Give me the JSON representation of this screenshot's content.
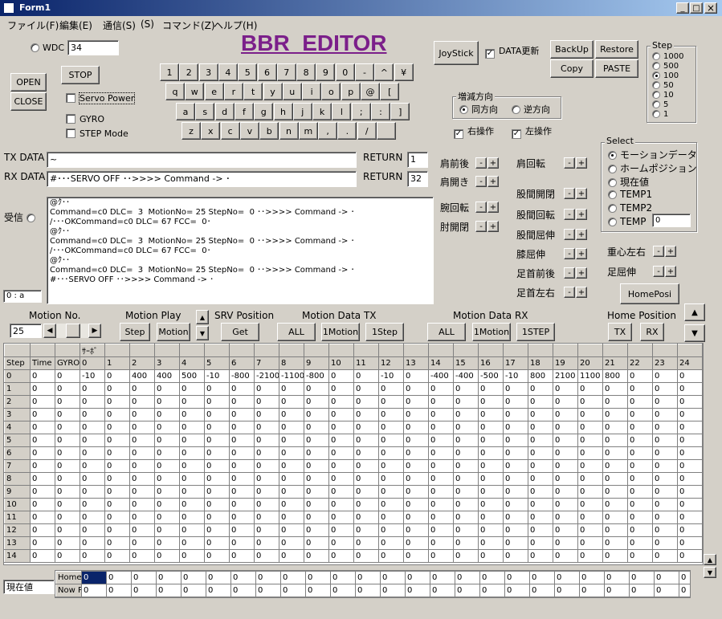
{
  "window": {
    "title": "Form1",
    "minimize": "_",
    "maximize": "□",
    "close": "×"
  },
  "menu": [
    "ファイル(F)",
    "編集(E)",
    "通信(S)",
    "(S)",
    "コマンド(Z)",
    "ヘルプ(H)"
  ],
  "app_title": "BBR  EDITOR",
  "wdc": {
    "label": "WDC",
    "value": "34"
  },
  "open_label": "OPEN",
  "close_label": "CLOSE",
  "stop_label": "STOP",
  "servo_power": "Servo Power",
  "gyro": "GYRO",
  "step_mode": "STEP Mode",
  "keyboard": [
    [
      "1",
      "2",
      "3",
      "4",
      "5",
      "6",
      "7",
      "8",
      "9",
      "0",
      "-",
      "^",
      "¥"
    ],
    [
      "q",
      "w",
      "e",
      "r",
      "t",
      "y",
      "u",
      "i",
      "o",
      "p",
      "@",
      "["
    ],
    [
      "a",
      "s",
      "d",
      "f",
      "g",
      "h",
      "j",
      "k",
      "l",
      ";",
      ":",
      "]"
    ],
    [
      "z",
      "x",
      "c",
      "v",
      "b",
      "n",
      "m",
      ",",
      ".",
      "/",
      ""
    ]
  ],
  "joystick": "JoyStick",
  "data_update": "DATA更新",
  "backup": "BackUp",
  "restore": "Restore",
  "copy": "Copy",
  "paste": "PASTE",
  "step_group": {
    "title": "Step",
    "options": [
      "1000",
      "500",
      "100",
      "50",
      "10",
      "5",
      "1"
    ],
    "selected": "100"
  },
  "direction": {
    "title": "増減方向",
    "same": "同方向",
    "reverse": "逆方向"
  },
  "right_op": "右操作",
  "left_op": "左操作",
  "tx": {
    "label": "TX DATA",
    "value": "~",
    "return_label": "RETURN",
    "return_value": "1"
  },
  "rx": {
    "label": "RX DATA",
    "value": "#･･･SERVO OFF ･･>>>> Command -> ･",
    "return_label": "RETURN",
    "return_value": "32"
  },
  "receive": {
    "label": "受信",
    "lines": [
      "@ｸ･･",
      "Command=c0 DLC=  3  MotionNo= 25 StepNo=  0 ･･>>>> Command -> ･",
      "/･･･OKCommand=c0 DLC= 67 FCC=  0･",
      "@ｸ･･",
      "Command=c0 DLC=  3  MotionNo= 25 StepNo=  0 ･･>>>> Command -> ･",
      "/･･･OKCommand=c0 DLC= 67 FCC=  0･",
      "@ｸ･･",
      "Command=c0 DLC=  3  MotionNo= 25 StepNo=  0 ･･>>>> Command -> ･",
      "#･･･SERVO OFF ･･>>>> Command -> ･"
    ]
  },
  "spin_value": "0 : a",
  "joints_left": [
    "肩前後",
    "肩開き",
    "腕回転",
    "肘開閉"
  ],
  "joints_right": [
    "肩回転",
    "股間開閉",
    "股間回転",
    "股間屈伸",
    "膝屈伸",
    "足首前後",
    "足首左右"
  ],
  "minus": "-",
  "plus": "+",
  "select_group": {
    "title": "Select",
    "options": [
      "モーションデータ",
      "ホームポジション",
      "現在値",
      "TEMP1",
      "TEMP2",
      "TEMP"
    ],
    "selected": "モーションデータ",
    "temp_value": "0"
  },
  "center_lr": "重心左右",
  "foot_flex": "足屈伸",
  "homeposi": "HomePosi",
  "motion_no": {
    "label": "Motion No.",
    "value": "25"
  },
  "motion_play": {
    "label": "Motion Play",
    "step": "Step",
    "motion": "Motion"
  },
  "srv_position": {
    "label": "SRV Position",
    "get": "Get"
  },
  "motion_tx": {
    "label": "Motion Data TX",
    "all": "ALL",
    "one_motion": "1Motion",
    "one_step": "1Step"
  },
  "motion_rx": {
    "label": "Motion Data RX",
    "all": "ALL",
    "one_motion": "1Motion",
    "one_step": "1STEP"
  },
  "home_position": {
    "label": "Home Position",
    "tx": "TX",
    "rx": "RX"
  },
  "grid": {
    "super": [
      "",
      "",
      "",
      "ｻｰﾎﾞ"
    ],
    "headers": [
      "Step",
      "Time",
      "GYRO",
      "0",
      "1",
      "2",
      "3",
      "4",
      "5",
      "6",
      "7",
      "8",
      "9",
      "10",
      "11",
      "12",
      "13",
      "14",
      "15",
      "16",
      "17",
      "18",
      "19",
      "20",
      "21",
      "22",
      "23",
      "24"
    ],
    "rows": [
      [
        "0",
        "0",
        "0",
        "-10",
        "0",
        "400",
        "400",
        "500",
        "-10",
        "-800",
        "-2100",
        "-1100",
        "-800",
        "0",
        "0",
        "-10",
        "0",
        "-400",
        "-400",
        "-500",
        "-10",
        "800",
        "2100",
        "1100",
        "800",
        "0",
        "0",
        "0"
      ],
      [
        "1",
        "0",
        "0",
        "0",
        "0",
        "0",
        "0",
        "0",
        "0",
        "0",
        "0",
        "0",
        "0",
        "0",
        "0",
        "0",
        "0",
        "0",
        "0",
        "0",
        "0",
        "0",
        "0",
        "0",
        "0",
        "0",
        "0",
        "0"
      ],
      [
        "2",
        "0",
        "0",
        "0",
        "0",
        "0",
        "0",
        "0",
        "0",
        "0",
        "0",
        "0",
        "0",
        "0",
        "0",
        "0",
        "0",
        "0",
        "0",
        "0",
        "0",
        "0",
        "0",
        "0",
        "0",
        "0",
        "0",
        "0"
      ],
      [
        "3",
        "0",
        "0",
        "0",
        "0",
        "0",
        "0",
        "0",
        "0",
        "0",
        "0",
        "0",
        "0",
        "0",
        "0",
        "0",
        "0",
        "0",
        "0",
        "0",
        "0",
        "0",
        "0",
        "0",
        "0",
        "0",
        "0",
        "0"
      ],
      [
        "4",
        "0",
        "0",
        "0",
        "0",
        "0",
        "0",
        "0",
        "0",
        "0",
        "0",
        "0",
        "0",
        "0",
        "0",
        "0",
        "0",
        "0",
        "0",
        "0",
        "0",
        "0",
        "0",
        "0",
        "0",
        "0",
        "0",
        "0"
      ],
      [
        "5",
        "0",
        "0",
        "0",
        "0",
        "0",
        "0",
        "0",
        "0",
        "0",
        "0",
        "0",
        "0",
        "0",
        "0",
        "0",
        "0",
        "0",
        "0",
        "0",
        "0",
        "0",
        "0",
        "0",
        "0",
        "0",
        "0",
        "0"
      ],
      [
        "6",
        "0",
        "0",
        "0",
        "0",
        "0",
        "0",
        "0",
        "0",
        "0",
        "0",
        "0",
        "0",
        "0",
        "0",
        "0",
        "0",
        "0",
        "0",
        "0",
        "0",
        "0",
        "0",
        "0",
        "0",
        "0",
        "0",
        "0"
      ],
      [
        "7",
        "0",
        "0",
        "0",
        "0",
        "0",
        "0",
        "0",
        "0",
        "0",
        "0",
        "0",
        "0",
        "0",
        "0",
        "0",
        "0",
        "0",
        "0",
        "0",
        "0",
        "0",
        "0",
        "0",
        "0",
        "0",
        "0",
        "0"
      ],
      [
        "8",
        "0",
        "0",
        "0",
        "0",
        "0",
        "0",
        "0",
        "0",
        "0",
        "0",
        "0",
        "0",
        "0",
        "0",
        "0",
        "0",
        "0",
        "0",
        "0",
        "0",
        "0",
        "0",
        "0",
        "0",
        "0",
        "0",
        "0"
      ],
      [
        "9",
        "0",
        "0",
        "0",
        "0",
        "0",
        "0",
        "0",
        "0",
        "0",
        "0",
        "0",
        "0",
        "0",
        "0",
        "0",
        "0",
        "0",
        "0",
        "0",
        "0",
        "0",
        "0",
        "0",
        "0",
        "0",
        "0",
        "0"
      ],
      [
        "10",
        "0",
        "0",
        "0",
        "0",
        "0",
        "0",
        "0",
        "0",
        "0",
        "0",
        "0",
        "0",
        "0",
        "0",
        "0",
        "0",
        "0",
        "0",
        "0",
        "0",
        "0",
        "0",
        "0",
        "0",
        "0",
        "0",
        "0"
      ],
      [
        "11",
        "0",
        "0",
        "0",
        "0",
        "0",
        "0",
        "0",
        "0",
        "0",
        "0",
        "0",
        "0",
        "0",
        "0",
        "0",
        "0",
        "0",
        "0",
        "0",
        "0",
        "0",
        "0",
        "0",
        "0",
        "0",
        "0",
        "0"
      ],
      [
        "12",
        "0",
        "0",
        "0",
        "0",
        "0",
        "0",
        "0",
        "0",
        "0",
        "0",
        "0",
        "0",
        "0",
        "0",
        "0",
        "0",
        "0",
        "0",
        "0",
        "0",
        "0",
        "0",
        "0",
        "0",
        "0",
        "0",
        "0"
      ],
      [
        "13",
        "0",
        "0",
        "0",
        "0",
        "0",
        "0",
        "0",
        "0",
        "0",
        "0",
        "0",
        "0",
        "0",
        "0",
        "0",
        "0",
        "0",
        "0",
        "0",
        "0",
        "0",
        "0",
        "0",
        "0",
        "0",
        "0",
        "0"
      ],
      [
        "14",
        "0",
        "0",
        "0",
        "0",
        "0",
        "0",
        "0",
        "0",
        "0",
        "0",
        "0",
        "0",
        "0",
        "0",
        "0",
        "0",
        "0",
        "0",
        "0",
        "0",
        "0",
        "0",
        "0",
        "0",
        "0",
        "0",
        "0"
      ]
    ]
  },
  "bottom": {
    "selector": "現在値",
    "rows": [
      {
        "label": "Home",
        "first": "0",
        "values": [
          "0",
          "0",
          "0",
          "0",
          "0",
          "0",
          "0",
          "0",
          "0",
          "0",
          "0",
          "0",
          "0",
          "0",
          "0",
          "0",
          "0",
          "0",
          "0",
          "0",
          "0",
          "0",
          "0",
          "0"
        ]
      },
      {
        "label": "Now P",
        "first": "0",
        "values": [
          "0",
          "0",
          "0",
          "0",
          "0",
          "0",
          "0",
          "0",
          "0",
          "0",
          "0",
          "0",
          "0",
          "0",
          "0",
          "0",
          "0",
          "0",
          "0",
          "0",
          "0",
          "0",
          "0",
          "0"
        ]
      }
    ]
  },
  "colors": {
    "titlebar_start": "#0a246a",
    "titlebar_end": "#a6caf0",
    "app_title": "#7b1f8a",
    "face": "#d4d0c8"
  }
}
